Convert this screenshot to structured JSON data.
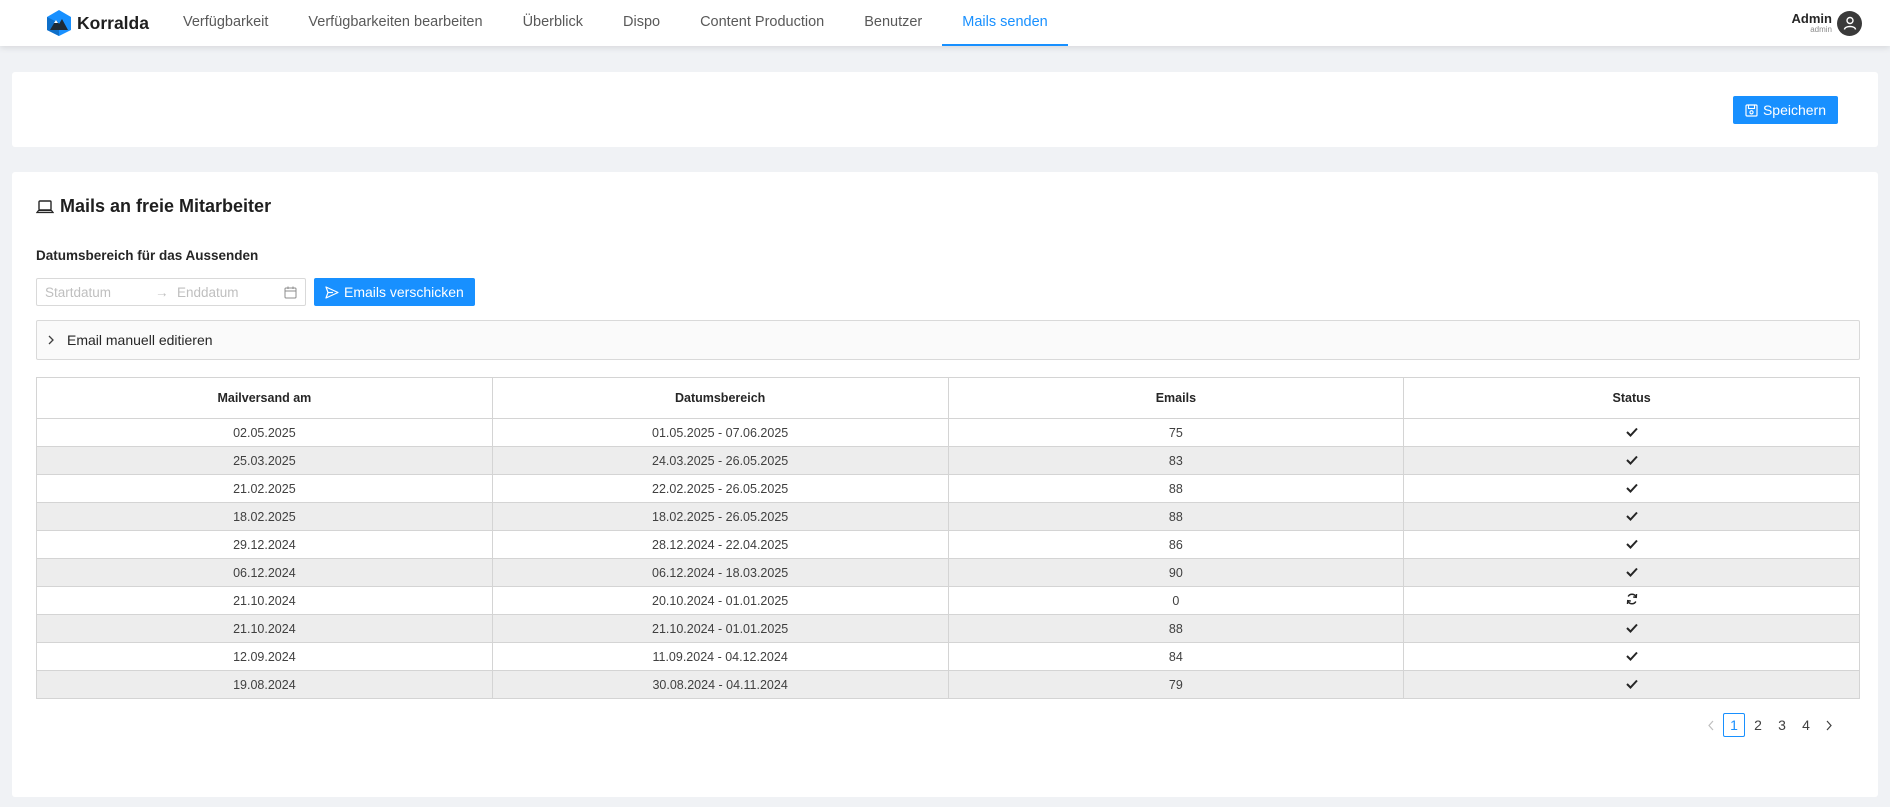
{
  "brand": {
    "name": "Korralda"
  },
  "nav": {
    "items": [
      {
        "label": "Verfügbarkeit",
        "active": false
      },
      {
        "label": "Verfügbarkeiten bearbeiten",
        "active": false
      },
      {
        "label": "Überblick",
        "active": false
      },
      {
        "label": "Dispo",
        "active": false
      },
      {
        "label": "Content Production",
        "active": false
      },
      {
        "label": "Benutzer",
        "active": false
      },
      {
        "label": "Mails senden",
        "active": true
      }
    ]
  },
  "user": {
    "name": "Admin",
    "role": "admin"
  },
  "toolbar": {
    "save_label": "Speichern"
  },
  "section": {
    "title": "Mails an freie Mitarbeiter",
    "range_label": "Datumsbereich für das Aussenden",
    "start_placeholder": "Startdatum",
    "end_placeholder": "Enddatum",
    "send_label": "Emails verschicken",
    "collapse_label": "Email manuell editieren"
  },
  "table": {
    "headers": [
      "Mailversand am",
      "Datumsbereich",
      "Emails",
      "Status"
    ],
    "rows": [
      {
        "sent": "02.05.2025",
        "range": "01.05.2025 - 07.06.2025",
        "emails": "75",
        "status": "done"
      },
      {
        "sent": "25.03.2025",
        "range": "24.03.2025 - 26.05.2025",
        "emails": "83",
        "status": "done"
      },
      {
        "sent": "21.02.2025",
        "range": "22.02.2025 - 26.05.2025",
        "emails": "88",
        "status": "done"
      },
      {
        "sent": "18.02.2025",
        "range": "18.02.2025 - 26.05.2025",
        "emails": "88",
        "status": "done"
      },
      {
        "sent": "29.12.2024",
        "range": "28.12.2024 - 22.04.2025",
        "emails": "86",
        "status": "done"
      },
      {
        "sent": "06.12.2024",
        "range": "06.12.2024 - 18.03.2025",
        "emails": "90",
        "status": "done"
      },
      {
        "sent": "21.10.2024",
        "range": "20.10.2024 - 01.01.2025",
        "emails": "0",
        "status": "pending"
      },
      {
        "sent": "21.10.2024",
        "range": "21.10.2024 - 01.01.2025",
        "emails": "88",
        "status": "done"
      },
      {
        "sent": "12.09.2024",
        "range": "11.09.2024 - 04.12.2024",
        "emails": "84",
        "status": "done"
      },
      {
        "sent": "19.08.2024",
        "range": "30.08.2024 - 04.11.2024",
        "emails": "79",
        "status": "done"
      }
    ]
  },
  "pagination": {
    "pages": [
      "1",
      "2",
      "3",
      "4"
    ],
    "current": "1"
  },
  "colors": {
    "accent": "#1890ff",
    "row_alt": "#ededed"
  },
  "icons": {
    "done": "check-icon",
    "pending": "sync-icon"
  }
}
